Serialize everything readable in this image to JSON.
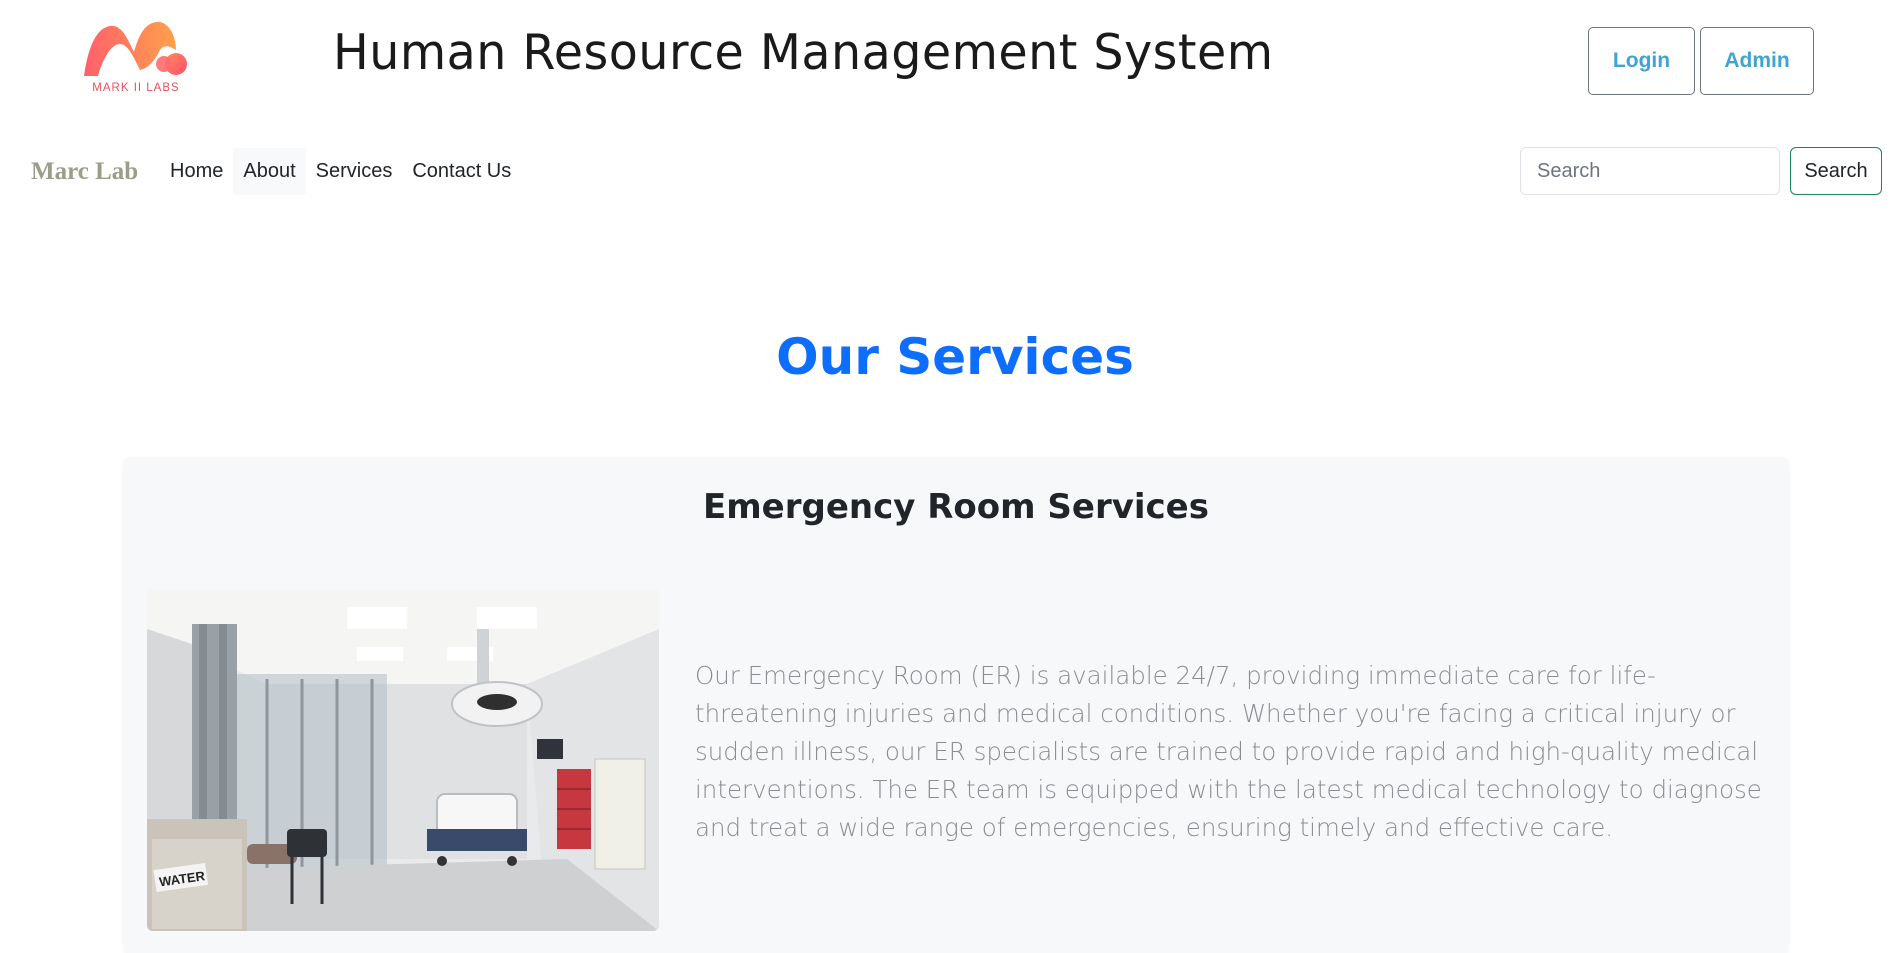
{
  "header": {
    "logo_text": "MARK II LABS",
    "title": "Human Resource Management System",
    "login_label": "Login",
    "admin_label": "Admin"
  },
  "nav": {
    "brand": "Marc Lab",
    "links": [
      "Home",
      "About",
      "Services",
      "Contact Us"
    ],
    "active": "About",
    "search_placeholder": "Search",
    "search_button": "Search"
  },
  "main": {
    "section_title": "Our Services",
    "service": {
      "title": "Emergency Room Services",
      "image_label": "WATER",
      "description": "Our Emergency Room (ER) is available 24/7, providing immediate care for life-threatening injuries and medical conditions. Whether you're facing a critical injury or sudden illness, our ER specialists are trained to provide rapid and high-quality medical interventions. The ER team is equipped with the latest medical technology to diagnose and treat a wide range of emergencies, ensuring timely and effective care."
    }
  },
  "colors": {
    "accent": "#0d6efd",
    "header_button_text": "#3fa4d0",
    "brand": "#9a9d88",
    "search_border": "#198754",
    "logo_gradient_start": "#ff7a59",
    "logo_gradient_end": "#e8505b"
  }
}
